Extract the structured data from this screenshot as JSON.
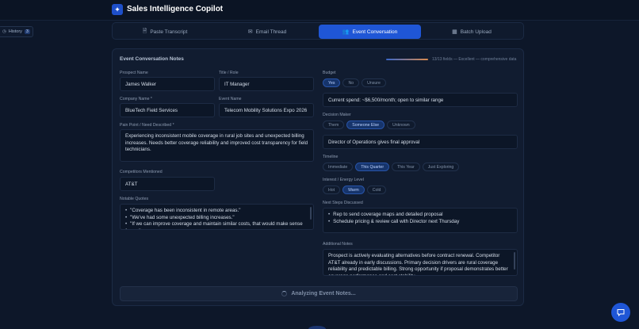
{
  "app": {
    "title": "Sales Intelligence Copilot",
    "logo_icon": "sparkle-icon",
    "accent": "#1f56d6"
  },
  "history": {
    "label": "History",
    "count": "3"
  },
  "tabs": [
    {
      "label": "Paste Transcript",
      "icon": "document-icon",
      "active": false
    },
    {
      "label": "Email Thread",
      "icon": "mail-icon",
      "active": false
    },
    {
      "label": "Event Conversation",
      "icon": "people-icon",
      "active": true
    },
    {
      "label": "Batch Upload",
      "icon": "calendar-icon",
      "active": false
    }
  ],
  "form": {
    "title": "Event Conversation Notes",
    "progress": {
      "filled": 13,
      "total": 13,
      "fraction": 1.0,
      "text": "13/13 fields — Excellent — comprehensive data"
    },
    "prospect_name": {
      "label": "Prospect Name",
      "value": "James Walker"
    },
    "title_role": {
      "label": "Title / Role",
      "value": "IT Manager"
    },
    "company_name": {
      "label": "Company Name *",
      "value": "BlueTech Field Services"
    },
    "event_name": {
      "label": "Event Name",
      "value": "Telecom Mobility Solutions Expo 2026"
    },
    "pain_point": {
      "label": "Pain Point / Need Described *",
      "value": "Experiencing inconsistent mobile coverage in rural job sites and unexpected billing increases. Needs better coverage reliability and improved cost transparency for field technicians."
    },
    "competitors": {
      "label": "Competitors Mentioned",
      "value": "AT&T"
    },
    "quotes": {
      "label": "Notable Quotes",
      "items": [
        "\"Coverage has been inconsistent in remote areas.\"",
        "\"We've had some unexpected billing increases.\"",
        "\"If we can improve coverage and maintain similar costs, that would make sense for us.\""
      ]
    },
    "budget": {
      "label": "Budget",
      "options": [
        "Yes",
        "No",
        "Unsure"
      ],
      "selected": "Yes",
      "detail": "Current spend: ~$6,500/month; open to similar range"
    },
    "decision_maker": {
      "label": "Decision Maker",
      "options": [
        "Them",
        "Someone Else",
        "Unknown"
      ],
      "selected": "Someone Else",
      "detail": "Director of Operations gives final approval"
    },
    "timeline": {
      "label": "Timeline",
      "options": [
        "Immediate",
        "This Quarter",
        "This Year",
        "Just Exploring"
      ],
      "selected": "This Quarter"
    },
    "interest": {
      "label": "Interest / Energy Level",
      "options": [
        "Hot",
        "Warm",
        "Cold"
      ],
      "selected": "Warm"
    },
    "next_steps": {
      "label": "Next Steps Discussed",
      "items": [
        "Rep to send coverage maps and detailed proposal",
        "Schedule pricing & review call with Director next Thursday"
      ]
    },
    "additional_notes": {
      "label": "Additional Notes",
      "value": "Prospect is actively evaluating alternatives before contract renewal. Competitor AT&T already in early discussions. Primary decision drivers are rural coverage reliability and predictable billing. Strong opportunity if proposal demonstrates better coverage performance and cost stability."
    },
    "analyze_button": "Analyzing Event Notes..."
  },
  "chat_icon": "chat-bubble-icon"
}
